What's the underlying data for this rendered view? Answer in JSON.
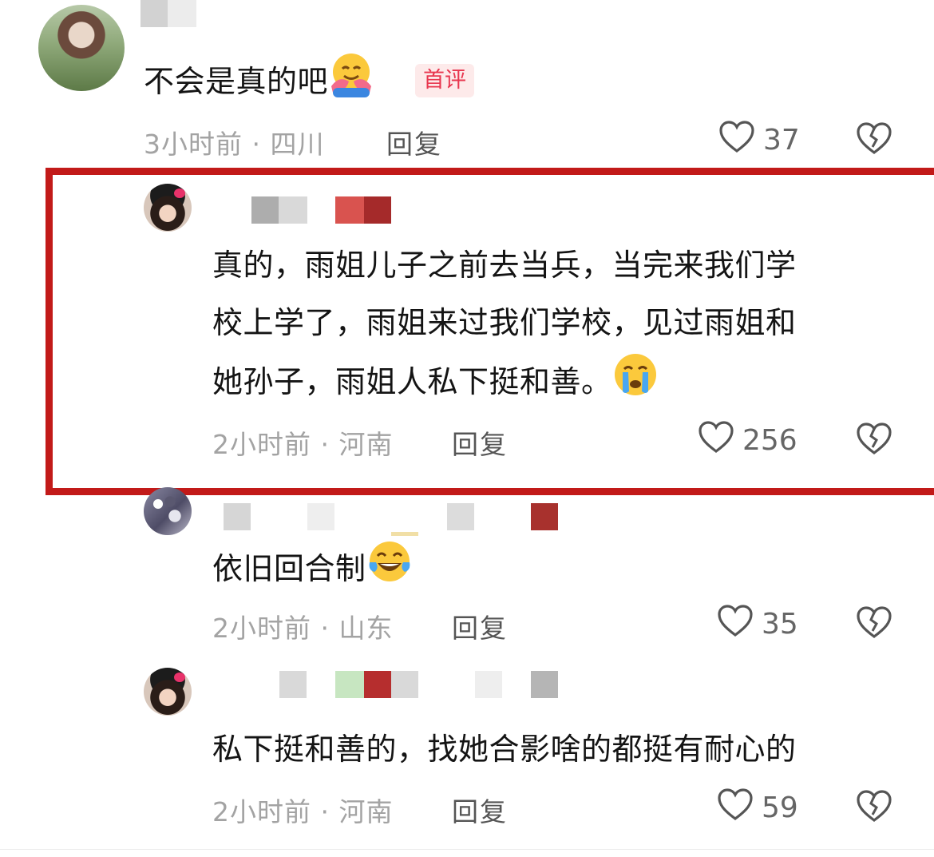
{
  "comments": [
    {
      "text": "不会是真的吧",
      "emoji": "hugging-face",
      "badge": "首评",
      "time": "3小时前",
      "location": "四川",
      "reply_label": "回复",
      "likes": "37"
    },
    {
      "text_lines": [
        "真的，雨姐儿子之前去当兵，当完来我们学",
        "校上学了，雨姐来过我们学校，见过雨姐和",
        "她孙子，雨姐人私下挺和善。"
      ],
      "emoji": "crying-face",
      "time": "2小时前",
      "location": "河南",
      "reply_label": "回复",
      "likes": "256",
      "highlighted": true
    },
    {
      "text": "依旧回合制",
      "emoji": "tears-of-joy-face",
      "time": "2小时前",
      "location": "山东",
      "reply_label": "回复",
      "likes": "35"
    },
    {
      "text": "私下挺和善的，找她合影啥的都挺有耐心的",
      "time": "2小时前",
      "location": "河南",
      "reply_label": "回复",
      "likes": "59"
    }
  ],
  "meta_separator": " · ",
  "colors": {
    "highlight_border": "#c21a19",
    "badge_bg": "#fdeaea",
    "badge_text": "#e8364f",
    "meta_text": "#a3a3a3"
  },
  "icons": [
    "heart-outline-icon",
    "broken-heart-icon"
  ]
}
